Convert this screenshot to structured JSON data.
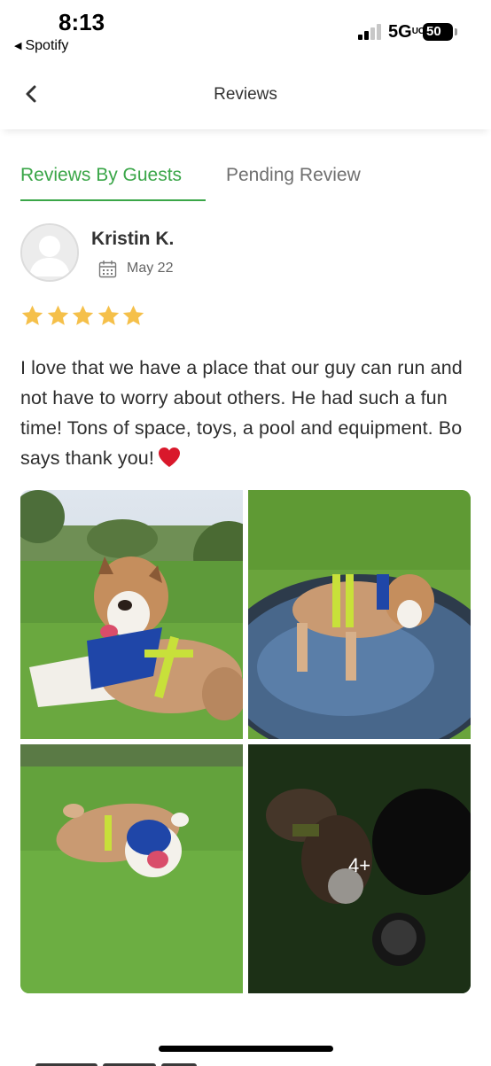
{
  "status_bar": {
    "time": "8:13",
    "back_app": "Spotify",
    "network": "5G",
    "network_suffix": "UC",
    "battery": "50"
  },
  "header": {
    "title": "Reviews",
    "back_icon": "chevron-left-icon"
  },
  "tabs": [
    {
      "label": "Reviews By Guests",
      "active": true
    },
    {
      "label": "Pending Review",
      "active": false
    }
  ],
  "review": {
    "reviewer_name": "Kristin K.",
    "date": "May 22",
    "rating": 5,
    "text": "I love that we have a place that our guy can run and not have to worry about others. He had such a fun time! Tons of space, toys, a pool and equipment. Bo says thank you!",
    "more_photos": "4+"
  },
  "colors": {
    "accent": "#3aa648",
    "star": "#f5c04a",
    "heart": "#d9182b"
  }
}
